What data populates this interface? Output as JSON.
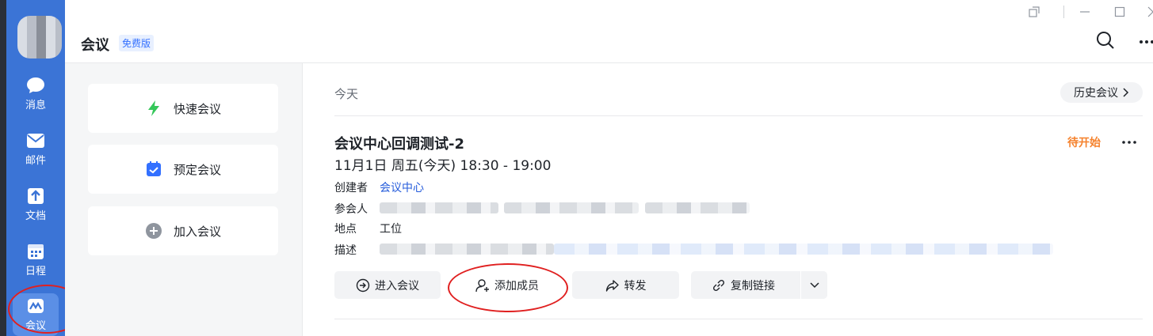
{
  "rail": {
    "items": [
      {
        "label": "消息",
        "icon": "chat-icon"
      },
      {
        "label": "邮件",
        "icon": "mail-icon"
      },
      {
        "label": "文档",
        "icon": "document-icon"
      },
      {
        "label": "日程",
        "icon": "calendar-icon"
      },
      {
        "label": "会议",
        "icon": "meeting-icon",
        "active": true
      }
    ]
  },
  "header": {
    "title": "会议",
    "edition": "免费版"
  },
  "actions": [
    {
      "label": "快速会议",
      "icon": "lightning-icon"
    },
    {
      "label": "预定会议",
      "icon": "calendar-check-icon"
    },
    {
      "label": "加入会议",
      "icon": "plus-circle-icon"
    }
  ],
  "main": {
    "day": "今天",
    "history_label": "历史会议",
    "meeting": {
      "title": "会议中心回调测试-2",
      "time": "11月1日 周五(今天) 18:30 - 19:00",
      "status": "待开始",
      "creator_label": "创建者",
      "creator": "会议中心",
      "attendees_label": "参会人",
      "location_label": "地点",
      "location": "工位",
      "description_label": "描述"
    },
    "buttons": {
      "enter": "进入会议",
      "add_member": "添加成员",
      "forward": "转发",
      "copy_link": "复制链接"
    }
  },
  "colors": {
    "rail": "#3b74d6",
    "accent": "#3370ff",
    "status": "#f5822d",
    "annotation": "#e02020"
  }
}
